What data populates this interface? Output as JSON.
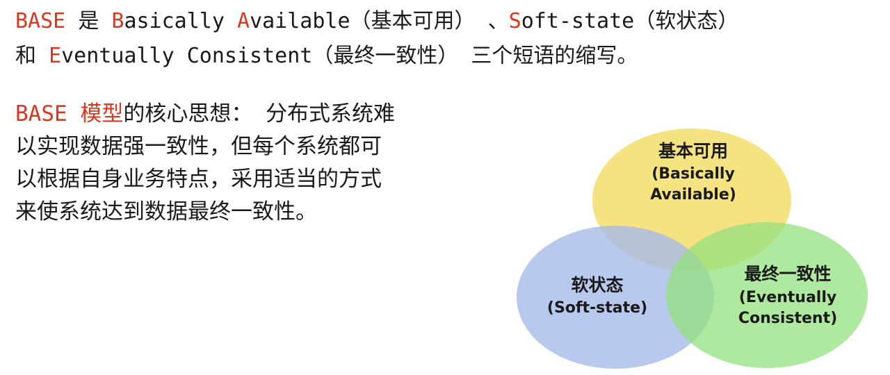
{
  "intro": {
    "line1": {
      "base": "BASE",
      "is": "是",
      "b_initial": "B",
      "b_rest": "asically",
      "a_initial": "A",
      "a_rest": "vailable（基本可用）",
      "sep": "、",
      "s_initial": "S",
      "s_rest": "oft-state（软状态）"
    },
    "line2": {
      "and": "和",
      "e_initial": "E",
      "e_rest": "ventually Consistent（最终一致性）",
      "suffix": "三个短语的缩写。"
    }
  },
  "core": {
    "highlight": "BASE 模型",
    "rows": [
      "的核心思想： 分布式系统难",
      "以实现数据强一致性，但每个系统都可",
      "以根据自身业务特点，采用适当的方式",
      "来使系统达到数据最终一致性。"
    ]
  },
  "venn": {
    "circles": [
      {
        "key": "basically_available",
        "cn": "基本可用",
        "en1": "(Basically",
        "en2": "Available)",
        "color": "#f3dd6a"
      },
      {
        "key": "soft_state",
        "cn": "软状态",
        "en1": "(Soft-state)",
        "en2": "",
        "color": "#a7bce8"
      },
      {
        "key": "eventually_consistent",
        "cn": "最终一致性",
        "en1": "(Eventually",
        "en2": "Consistent)",
        "color": "#94e07f"
      }
    ]
  },
  "colors": {
    "accent": "#d9381e",
    "text": "#1a1a1a"
  }
}
